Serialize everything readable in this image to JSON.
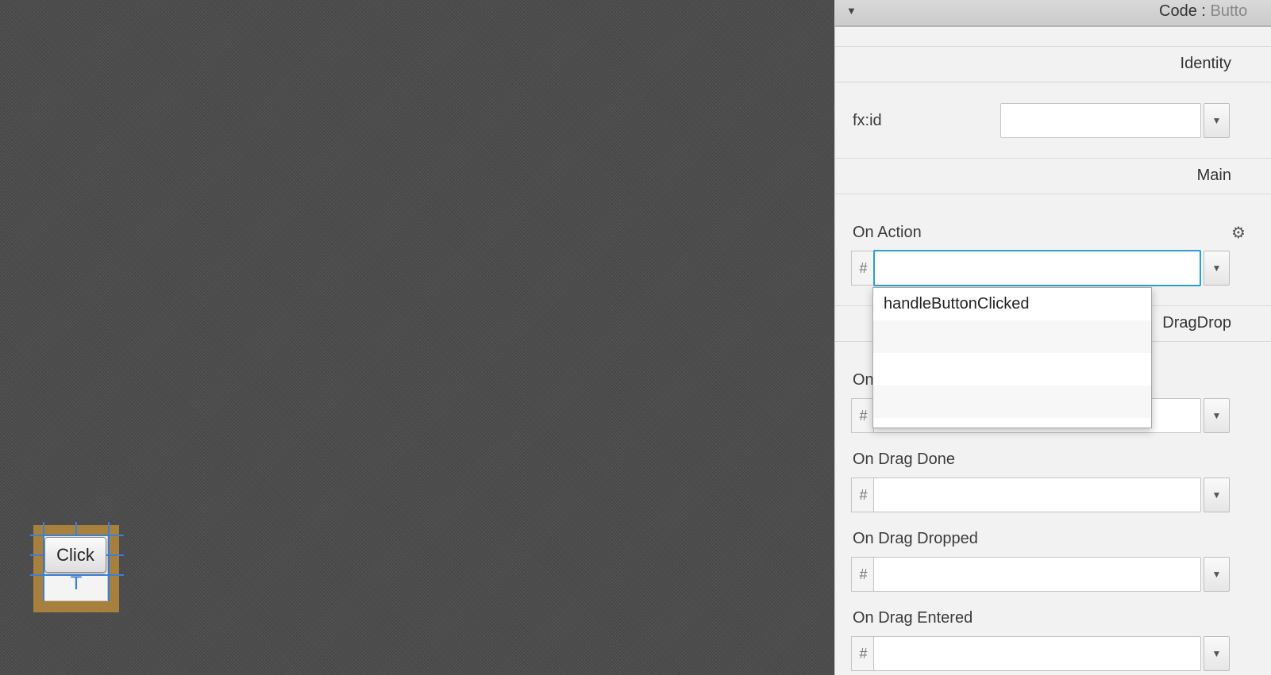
{
  "canvas": {
    "button_label": "Click",
    "anchor_marker": "T"
  },
  "inspector": {
    "title": "Code",
    "title_separator": ":",
    "title_sub": "Butto",
    "collapse_glyph": "▼",
    "dropdown_glyph": "▼",
    "hash_glyph": "#",
    "gear_glyph": "⚙",
    "identity": {
      "section_label": "Identity",
      "fx_id_label": "fx:id",
      "fx_id_value": ""
    },
    "main": {
      "section_label": "Main",
      "on_action_label": "On Action",
      "on_action_value": ""
    },
    "dragdrop": {
      "section_label": "DragDrop",
      "partial_label": "On",
      "on_drag_done_label": "On Drag Done",
      "on_drag_dropped_label": "On Drag Dropped",
      "on_drag_entered_label": "On Drag Entered"
    }
  },
  "popup": {
    "items": [
      "handleButtonClicked",
      "",
      "",
      ""
    ]
  }
}
